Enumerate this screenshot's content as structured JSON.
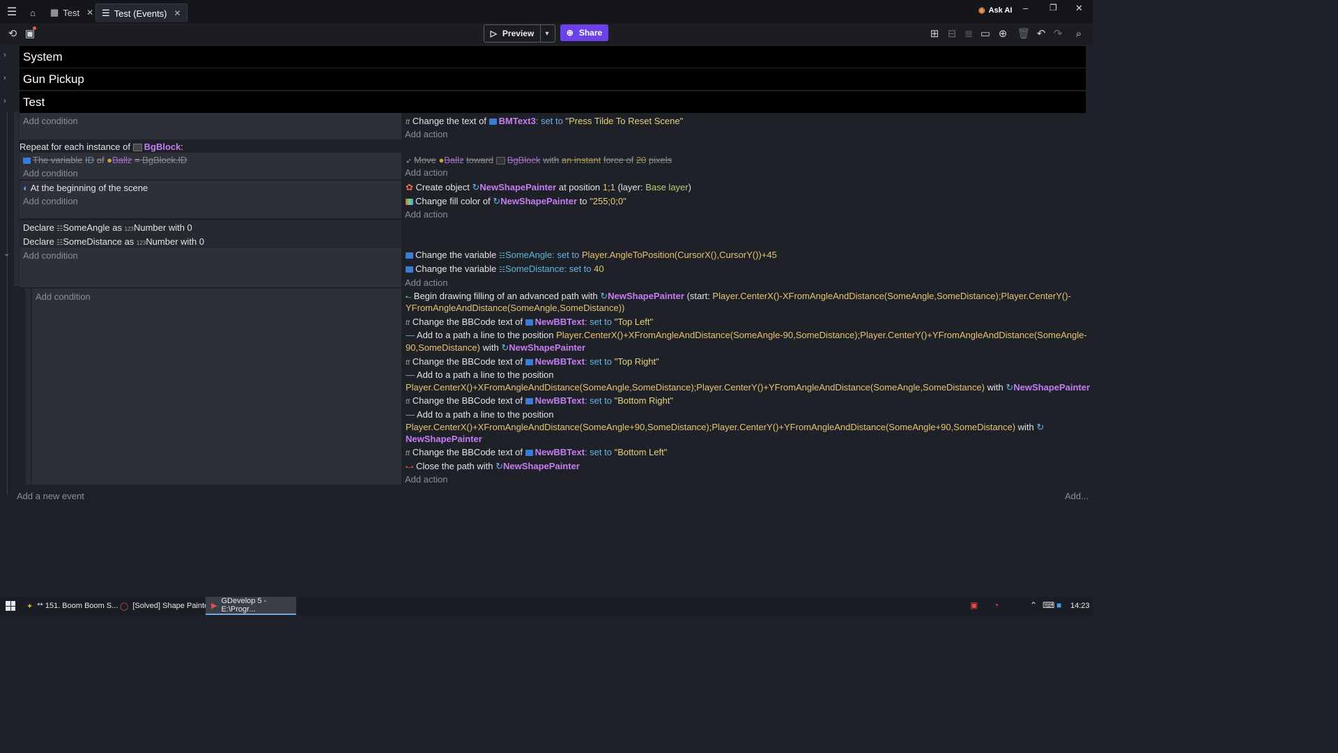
{
  "window": {
    "tabs": [
      {
        "label": "Test"
      },
      {
        "label": "Test (Events)"
      }
    ],
    "ask_ai": "Ask AI",
    "controls": [
      "–",
      "❐",
      "✕"
    ]
  },
  "toolbar": {
    "preview_label": "Preview",
    "share_label": "Share"
  },
  "groups": [
    {
      "label": "System"
    },
    {
      "label": "Gun Pickup"
    },
    {
      "label": "Test"
    }
  ],
  "events": {
    "add_condition": "Add condition",
    "add_action": "Add action",
    "e1": {
      "action": {
        "pre": "Change the text of",
        "obj": "BMText3",
        "op": ": set to",
        "val": "\"Press Tilde To Reset Scene\""
      }
    },
    "e2": {
      "repeat": {
        "pre": "Repeat for each instance of",
        "obj": "BgBlock",
        "post": ":"
      },
      "cond": {
        "a": "The variable",
        "b": "ID",
        "c": "of",
        "d": "Ballz",
        "e": "= BgBlock.ID"
      },
      "action": {
        "a": "Move",
        "b": "Ballz",
        "c": "toward",
        "d": "BgBlock",
        "e": "with",
        "f": "an instant",
        "g": "force of",
        "h": "20",
        "i": "pixels"
      }
    },
    "e3": {
      "cond": "At the beginning of the scene",
      "a1": {
        "pre": "Create object",
        "obj": "NewShapePainter",
        "mid": "at position",
        "val": "1;1",
        "post1": "(layer:",
        "layer": "Base layer",
        "post2": ")"
      },
      "a2": {
        "pre": "Change fill color of",
        "obj": "NewShapePainter",
        "mid": "to",
        "val": "\"255;0;0\""
      }
    },
    "e4": {
      "decl1": {
        "pre": "Declare",
        "name": "SomeAngle",
        "mid": "as",
        "type": "Number",
        "post": "with 0"
      },
      "decl2": {
        "pre": "Declare",
        "name": "SomeDistance",
        "mid": "as",
        "type": "Number",
        "post": "with 0"
      },
      "a1": {
        "pre": "Change the variable",
        "var": "SomeAngle",
        "op": ": set to",
        "val": "Player.AngleToPosition(CursorX(),CursorY())+45"
      },
      "a2": {
        "pre": "Change the variable",
        "var": "SomeDistance",
        "op": ": set to",
        "val": "40"
      }
    },
    "e5": {
      "a1": {
        "pre": "Begin drawing filling of an advanced path with",
        "obj": "NewShapePainter",
        "mid": "(start:",
        "val1": "Player.CenterX()-XFromAngleAndDistance(SomeAngle,SomeDistance);Player.CenterY()-",
        "val2": "YFromAngleAndDistance(SomeAngle,SomeDistance))"
      },
      "a2": {
        "pre": "Change the BBCode text of",
        "obj": "NewBBText",
        "op": ": set to",
        "val": "\"Top Left\""
      },
      "a3": {
        "pre": "Add to a path a line to the position",
        "val1": "Player.CenterX()+XFromAngleAndDistance(SomeAngle-90,SomeDistance);Player.CenterY()+YFromAngleAndDistance(SomeAngle-",
        "val2": "90,SomeDistance)",
        "mid": "with",
        "obj": "NewShapePainter"
      },
      "a4": {
        "pre": "Change the BBCode text of",
        "obj": "NewBBText",
        "op": ": set to",
        "val": "\"Top Right\""
      },
      "a5": {
        "pre": "Add to a path a line to the position",
        "val": "Player.CenterX()+XFromAngleAndDistance(SomeAngle,SomeDistance);Player.CenterY()+YFromAngleAndDistance(SomeAngle,SomeDistance)",
        "mid": "with",
        "obj": "NewShapePainter"
      },
      "a6": {
        "pre": "Change the BBCode text of",
        "obj": "NewBBText",
        "op": ": set to",
        "val": "\"Bottom Right\""
      },
      "a7": {
        "pre": "Add to a path a line to the position",
        "val": "Player.CenterX()+XFromAngleAndDistance(SomeAngle+90,SomeDistance);Player.CenterY()+YFromAngleAndDistance(SomeAngle+90,SomeDistance)",
        "mid": "with",
        "obj": "NewShapePainter"
      },
      "a8": {
        "pre": "Change the BBCode text of",
        "obj": "NewBBText",
        "op": ": set to",
        "val": "\"Bottom Left\""
      },
      "a9": {
        "pre": "Close the path with",
        "obj": "NewShapePainter"
      }
    },
    "add_event": "Add a new event",
    "add_more": "Add..."
  },
  "taskbar": {
    "items": [
      {
        "label": "** 151. Boom Boom S..."
      },
      {
        "label": "[Solved] Shape Painte..."
      },
      {
        "label": "GDevelop 5 - E:\\Progr..."
      }
    ],
    "clock": "14:23"
  }
}
